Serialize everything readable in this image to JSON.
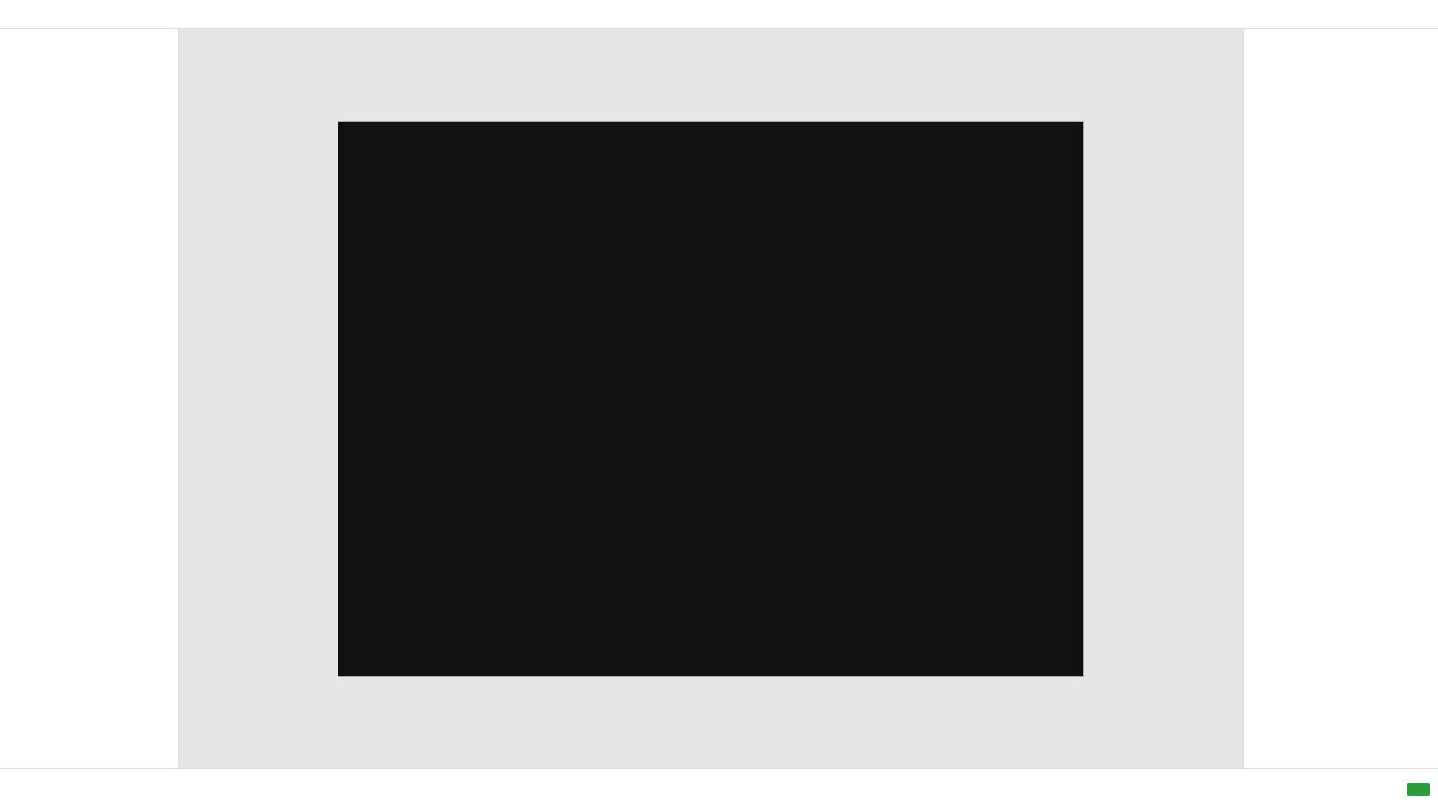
{
  "window": {
    "title": ""
  },
  "left": {
    "heading": ""
  },
  "right": {
    "heading": ""
  },
  "bottom": {
    "summary": "",
    "action": ""
  }
}
